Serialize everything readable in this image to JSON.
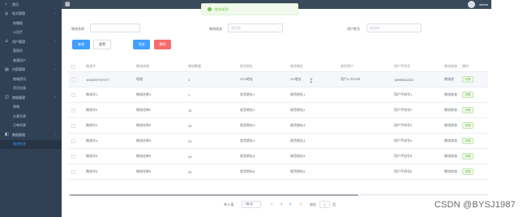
{
  "sidebar": {
    "items": [
      {
        "label": "首页",
        "type": "group",
        "icon": "home-icon"
      },
      {
        "label": "轮式管理",
        "type": "group",
        "icon": "wheel-icon",
        "caret": true
      },
      {
        "label": "轮播图",
        "type": "sub"
      },
      {
        "label": "公告栏",
        "type": "sub"
      },
      {
        "label": "用户管理",
        "type": "group",
        "icon": "user-icon",
        "caret": true
      },
      {
        "label": "管理员",
        "type": "sub"
      },
      {
        "label": "普通用户",
        "type": "sub"
      },
      {
        "label": "内容管理",
        "type": "group",
        "icon": "content-icon",
        "caret": true
      },
      {
        "label": "商城资讯",
        "type": "sub"
      },
      {
        "label": "资讯分类",
        "type": "sub"
      },
      {
        "label": "商城管理",
        "type": "group",
        "icon": "shop-icon",
        "caret": true
      },
      {
        "label": "商城",
        "type": "sub"
      },
      {
        "label": "分类列表",
        "type": "sub"
      },
      {
        "label": "订单列表",
        "type": "sub"
      },
      {
        "label": "数据管理",
        "type": "group",
        "icon": "data-icon",
        "caret": true
      },
      {
        "label": "物流信息",
        "type": "sub",
        "active": true
      }
    ]
  },
  "topbar": {
    "username": "admin"
  },
  "toast": {
    "message": "提交成功!"
  },
  "filters": {
    "f1_label": "物流名称",
    "f1_placeholder": "",
    "f2_label": "物流状态",
    "f2_placeholder": "请选择",
    "f3_label": "用户姓名",
    "f3_placeholder": "请选择"
  },
  "buttons": {
    "search": "查询",
    "reset": "重置",
    "add": "添加",
    "delete": "删除"
  },
  "table": {
    "columns": [
      "物流号",
      "物流名称",
      "物流数量",
      "发货地址",
      "收货地址",
      "收货用户",
      "用户手机号",
      "物流状态",
      "操作"
    ],
    "detail_label": "详情",
    "rows": [
      [
        "1645299757977",
        "短裙",
        "1",
        "XXX地址",
        "XX地址",
        "用户1:爪2233",
        "18955552222",
        "物流状"
      ],
      [
        "物流号1",
        "物流名称1",
        "1",
        "发货地址1",
        "收货地址1",
        "",
        "用户手机号1",
        "物流状态"
      ],
      [
        "物流号2",
        "物流名称2",
        "10",
        "发货地址2",
        "收货地址2",
        "",
        "用户手机号2",
        "物流状态"
      ],
      [
        "物流号3",
        "物流名称3",
        "15",
        "发货地址3",
        "收货地址3",
        "",
        "用户手机号3",
        "物流状态"
      ],
      [
        "物流号4",
        "物流名称4",
        "20",
        "发货地址4",
        "收货地址4",
        "",
        "用户手机号4",
        "物流状态"
      ],
      [
        "物流号5",
        "物流名称5",
        "25",
        "发货地址5",
        "收货地址5",
        "",
        "用户手机号5",
        "物流状态"
      ],
      [
        "物流号6",
        "物流名称6",
        "30",
        "发货地址6",
        "收货地址6",
        "",
        "用户手机号6",
        "物流状态"
      ]
    ]
  },
  "pagination": {
    "total": "共 5 条",
    "page_size": "7条/页",
    "prev": "<",
    "pages": [
      "1",
      "2"
    ],
    "current": "2",
    "next": ">",
    "goto": "前往",
    "goto_value": "1",
    "goto_unit": "页"
  },
  "watermark": "CSDN @BYSJ1987"
}
